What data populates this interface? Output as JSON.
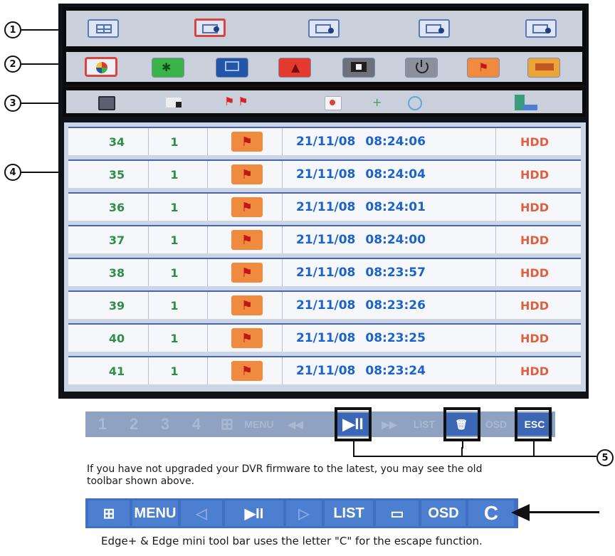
{
  "callouts": [
    "1",
    "2",
    "3",
    "4",
    "5"
  ],
  "toolbar_layouts": {
    "icons": [
      "grid-layout-icon",
      "camera-playback-icon",
      "camera-playback-icon",
      "camera-playback-icon",
      "camera-playback-icon"
    ],
    "active_index": 1
  },
  "toolbar_events": {
    "icons": [
      {
        "name": "all-events-icon",
        "color": "#ffffff"
      },
      {
        "name": "motion-icon",
        "color": "#3bb24a"
      },
      {
        "name": "video-loss-icon",
        "color": "#2456a8"
      },
      {
        "name": "alarm-icon",
        "color": "#e23a2e"
      },
      {
        "name": "video-record-icon",
        "color": "#2c2c2c"
      },
      {
        "name": "power-icon",
        "color": "#555b66"
      },
      {
        "name": "sensor-icon",
        "color": "#f08a3e"
      },
      {
        "name": "hdd-icon",
        "color": "#e9a53a"
      }
    ]
  },
  "toolbar_filters": {
    "icons": [
      "document-icon",
      "camera-icon",
      "flags-icon",
      "calendar-icon",
      "plus-icon",
      "clock-icon",
      "hdd-storage-icon"
    ]
  },
  "event_list": {
    "rows": [
      {
        "num": "34",
        "ch": "1",
        "date": "21/11/08",
        "time": "08:24:06",
        "device": "HDD"
      },
      {
        "num": "35",
        "ch": "1",
        "date": "21/11/08",
        "time": "08:24:04",
        "device": "HDD"
      },
      {
        "num": "36",
        "ch": "1",
        "date": "21/11/08",
        "time": "08:24:01",
        "device": "HDD"
      },
      {
        "num": "37",
        "ch": "1",
        "date": "21/11/08",
        "time": "08:24:00",
        "device": "HDD"
      },
      {
        "num": "38",
        "ch": "1",
        "date": "21/11/08",
        "time": "08:23:57",
        "device": "HDD"
      },
      {
        "num": "39",
        "ch": "1",
        "date": "21/11/08",
        "time": "08:23:26",
        "device": "HDD"
      },
      {
        "num": "40",
        "ch": "1",
        "date": "21/11/08",
        "time": "08:23:25",
        "device": "HDD"
      },
      {
        "num": "41",
        "ch": "1",
        "date": "21/11/08",
        "time": "08:23:24",
        "device": "HDD"
      }
    ]
  },
  "old_toolbar": {
    "buttons": [
      "1",
      "2",
      "3",
      "4",
      "⊞",
      "MENU",
      "◀◀",
      "▶II",
      "▶▶",
      "LIST",
      "🗑",
      "OSD",
      "ESC"
    ]
  },
  "old_toolbar_caption": "If you have not upgraded your DVR firmware to the latest, you may see the old toolbar shown above.",
  "new_toolbar": {
    "buttons": [
      "⊞",
      "MENU",
      "◁",
      "▶II",
      "▷",
      "LIST",
      "▭",
      "OSD",
      "C"
    ]
  },
  "new_toolbar_caption": "Edge+ & Edge mini tool bar uses the letter \"C\" for the escape function."
}
